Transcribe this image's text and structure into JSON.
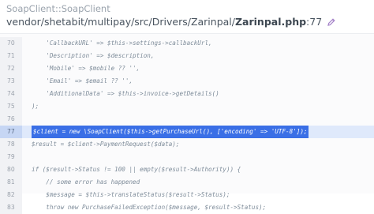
{
  "header": {
    "exception_class": "SoapClient::SoapClient",
    "file_path": "vendor/shetabit/multipay/src/Drivers/Zarinpal/",
    "file_name": "Zarinpal.php",
    "line_suffix": ":77",
    "edit_icon": "pencil-icon"
  },
  "code": {
    "highlighted_line": "77",
    "lines": [
      {
        "num": "70",
        "text": "    'CallbackURL' => $this->settings->callbackUrl,"
      },
      {
        "num": "71",
        "text": "    'Description' => $description,"
      },
      {
        "num": "72",
        "text": "    'Mobile' => $mobile ?? '',"
      },
      {
        "num": "73",
        "text": "    'Email' => $email ?? '',"
      },
      {
        "num": "74",
        "text": "    'AdditionalData' => $this->invoice->getDetails()"
      },
      {
        "num": "75",
        "text": ");"
      },
      {
        "num": "76",
        "text": ""
      },
      {
        "num": "77",
        "text": "$client = new \\SoapClient($this->getPurchaseUrl(), ['encoding' => 'UTF-8']);"
      },
      {
        "num": "78",
        "text": "$result = $client->PaymentRequest($data);"
      },
      {
        "num": "79",
        "text": ""
      },
      {
        "num": "80",
        "text": "if ($result->Status != 100 || empty($result->Authority)) {"
      },
      {
        "num": "81",
        "text": "    // some error has happened"
      },
      {
        "num": "82",
        "text": "    $message = $this->translateStatus($result->Status);"
      },
      {
        "num": "83",
        "text": "    throw new PurchaseFailedException($message, $result->Status);"
      }
    ]
  }
}
